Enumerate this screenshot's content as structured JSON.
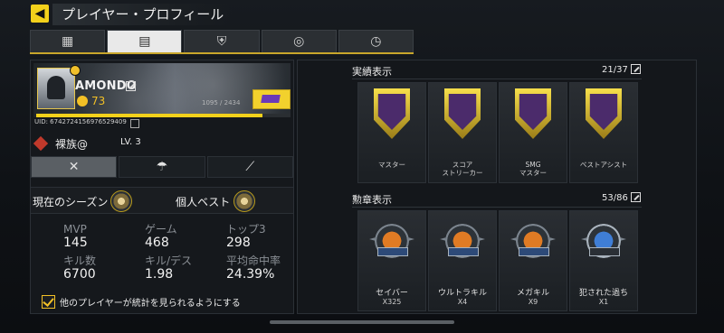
{
  "title": "プレイヤー・プロフィール",
  "tabs": [
    {
      "icon": "stats-chart-icon",
      "active": false
    },
    {
      "icon": "profile-card-icon",
      "active": true
    },
    {
      "icon": "badge-icon",
      "active": false
    },
    {
      "icon": "emblem-icon",
      "active": false
    },
    {
      "icon": "timer-icon",
      "active": false
    }
  ],
  "profile": {
    "name": "AMONDO",
    "level": "73",
    "progress_text": "1095 / 2434",
    "xp_fraction": 0.88,
    "uid": "UID: 6742724156976529409"
  },
  "clan": {
    "name": "裸族@",
    "level": "LV. 3"
  },
  "mode_tabs": [
    {
      "icon": "multiplayer-icon",
      "active": true
    },
    {
      "icon": "parachute-icon",
      "active": false
    },
    {
      "icon": "arm-icon",
      "active": false
    }
  ],
  "season": {
    "label": "現在のシーズン",
    "best_label": "個人ベスト"
  },
  "stats": [
    {
      "label": "MVP",
      "value": "145"
    },
    {
      "label": "ゲーム",
      "value": "468"
    },
    {
      "label": "トップ3",
      "value": "298"
    },
    {
      "label": "キル数",
      "value": "6700"
    },
    {
      "label": "キル/デス",
      "value": "1.98"
    },
    {
      "label": "平均命中率",
      "value": "24.39%"
    }
  ],
  "checkbox": {
    "label": "他のプレイヤーが統計を見られるようにする",
    "checked": true
  },
  "achievements": {
    "title": "実績表示",
    "count": "21/37",
    "items": [
      {
        "label": "マスター"
      },
      {
        "label": "スコア\nストリーカー"
      },
      {
        "label": "SMG\nマスター"
      },
      {
        "label": "ベストアシスト"
      }
    ]
  },
  "medals": {
    "title": "勲章表示",
    "count": "53/86",
    "items": [
      {
        "name": "セイバー",
        "count": "X325",
        "color": "#e07b24"
      },
      {
        "name": "ウルトラキル",
        "count": "X4",
        "color": "#e07b24"
      },
      {
        "name": "メガキル",
        "count": "X9",
        "color": "#e07b24"
      },
      {
        "name": "犯された過ち",
        "count": "X1",
        "color": "#3f7ed6"
      }
    ]
  },
  "colors": {
    "accent": "#f3d11b",
    "text": "#e6e6e6",
    "muted": "#8a8f95"
  }
}
